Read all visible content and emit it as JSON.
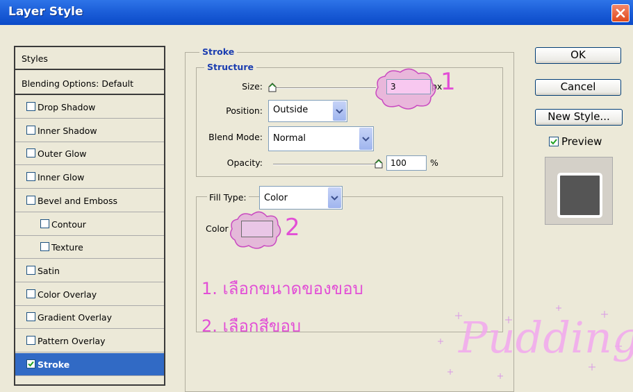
{
  "window": {
    "title": "Layer Style"
  },
  "styles_list": {
    "header": "Styles",
    "blending": "Blending Options: Default",
    "items": [
      {
        "label": "Drop Shadow",
        "checked": false,
        "indent": false
      },
      {
        "label": "Inner Shadow",
        "checked": false,
        "indent": false
      },
      {
        "label": "Outer Glow",
        "checked": false,
        "indent": false
      },
      {
        "label": "Inner Glow",
        "checked": false,
        "indent": false
      },
      {
        "label": "Bevel and Emboss",
        "checked": false,
        "indent": false
      },
      {
        "label": "Contour",
        "checked": false,
        "indent": true
      },
      {
        "label": "Texture",
        "checked": false,
        "indent": true
      },
      {
        "label": "Satin",
        "checked": false,
        "indent": false
      },
      {
        "label": "Color Overlay",
        "checked": false,
        "indent": false
      },
      {
        "label": "Gradient Overlay",
        "checked": false,
        "indent": false
      },
      {
        "label": "Pattern Overlay",
        "checked": false,
        "indent": false
      },
      {
        "label": "Stroke",
        "checked": true,
        "indent": false,
        "selected": true
      }
    ]
  },
  "stroke": {
    "title": "Stroke",
    "structure": {
      "title": "Structure",
      "size_label": "Size:",
      "size_value": "3",
      "size_unit": "px",
      "size_slider_fraction": 0.0,
      "position_label": "Position:",
      "position_value": "Outside",
      "blend_label": "Blend Mode:",
      "blend_value": "Normal",
      "opacity_label": "Opacity:",
      "opacity_value": "100",
      "opacity_unit": "%",
      "opacity_slider_fraction": 1.0
    },
    "fill": {
      "type_label": "Fill Type:",
      "type_value": "Color",
      "color_label": "Color",
      "color_swatch": "#e9c6e6"
    }
  },
  "buttons": {
    "ok": "OK",
    "cancel": "Cancel",
    "new_style": "New Style...",
    "preview_label": "Preview",
    "preview_checked": true
  },
  "annotations": {
    "mark1": "1",
    "mark2": "2",
    "note1": "1. เลือกขนาดของขอบ",
    "note2": "2. เลือกสีขอบ",
    "watermark": "Pudding",
    "color": "#e24fd6"
  },
  "colors": {
    "titlebar": "#0b4ac8",
    "selection": "#316ac5",
    "legend": "#1b3db0",
    "dialog_bg": "#ece9d8"
  }
}
